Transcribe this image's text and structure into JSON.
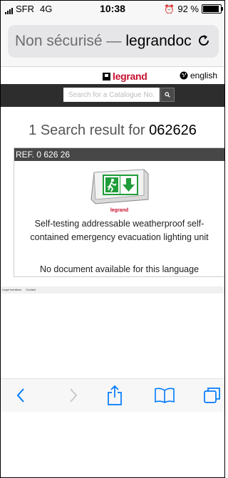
{
  "status_bar": {
    "carrier": "SFR",
    "network": "4G",
    "time": "10:38",
    "battery": "92 %"
  },
  "browser": {
    "url_security": "Non sécurisé —",
    "url_domain": "legrandoc",
    "accent_color": "#007aff"
  },
  "site": {
    "brand": "legrand",
    "brand_color": "#c8102e",
    "language": "english",
    "search": {
      "placeholder": "Search for a Catalogue No.",
      "value": ""
    },
    "result": {
      "count": "1",
      "text": "Search result for",
      "query": "062626"
    },
    "card": {
      "ref": "REF. 0 626 26",
      "product_logo": "legrand",
      "description": "Self-testing addressable weatherproof self-contained emergency evacuation lighting unit",
      "no_document": "No document available for this language"
    },
    "footer": {
      "legal": "Legal mentions",
      "contact": "Contact"
    }
  },
  "toolbar": {
    "items": [
      "back-icon",
      "forward-icon",
      "share-icon",
      "bookmarks-icon",
      "tabs-icon"
    ]
  }
}
